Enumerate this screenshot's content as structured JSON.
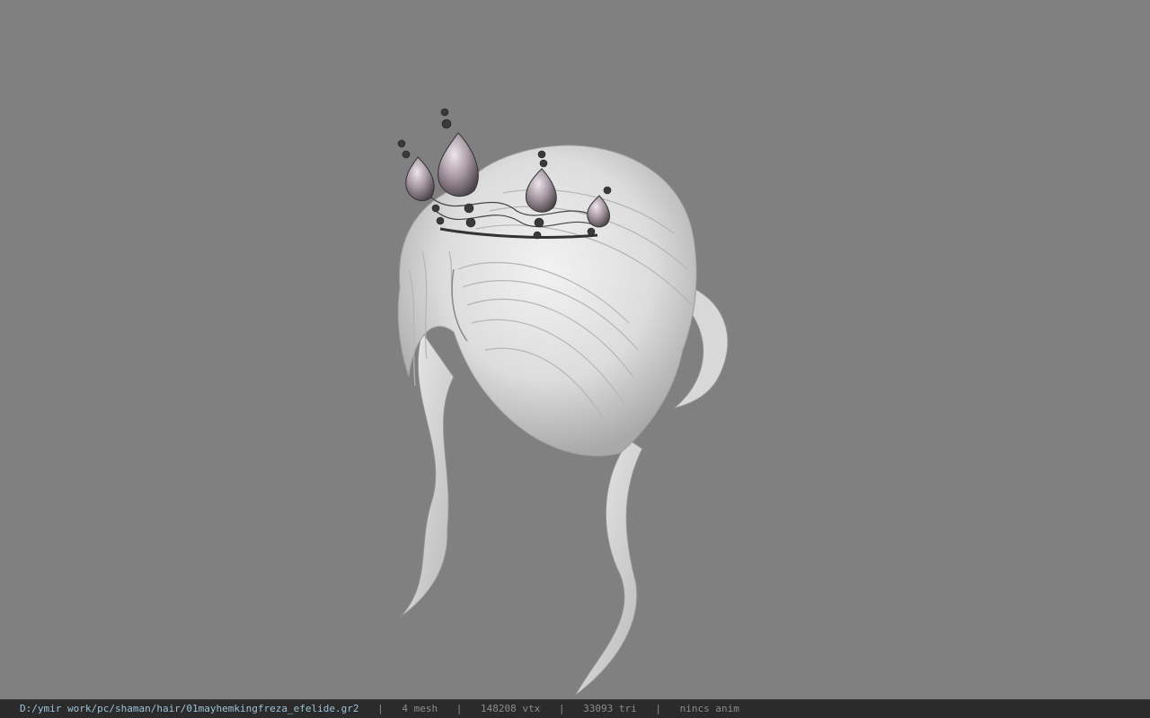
{
  "viewport": {
    "background": "#808080",
    "model_description_icon": "hair-model"
  },
  "statusbar": {
    "path": "D:/ymir work/pc/shaman/hair/01mayhemkingfreza_efelide.gr2",
    "separator": "|",
    "mesh": "4 mesh",
    "vtx": "148208 vtx",
    "tri": "33093 tri",
    "anim": "nincs anim"
  }
}
